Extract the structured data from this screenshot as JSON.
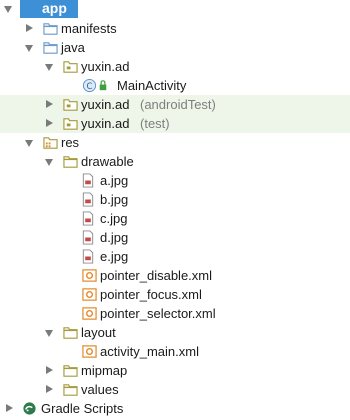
{
  "tree": {
    "app": "app",
    "manifests": "manifests",
    "java": "java",
    "pkg_main": "yuxin.ad",
    "main_activity": "MainActivity",
    "pkg_android_test": "yuxin.ad",
    "android_test_suffix": "(androidTest)",
    "pkg_test": "yuxin.ad",
    "test_suffix": "(test)",
    "res": "res",
    "drawable": "drawable",
    "files_drawable": [
      "a.jpg",
      "b.jpg",
      "c.jpg",
      "d.jpg",
      "e.jpg",
      "pointer_disable.xml",
      "pointer_focus.xml",
      "pointer_selector.xml"
    ],
    "layout": "layout",
    "activity_main": "activity_main.xml",
    "mipmap": "mipmap",
    "values": "values",
    "gradle_scripts": "Gradle Scripts"
  },
  "colors": {
    "selection": "#3d8fd6",
    "highlight_row": "#edf6e8",
    "folder_blue": "#6a9ac9",
    "package_olive": "#a49a3a",
    "xml_orange": "#e38b2c"
  }
}
